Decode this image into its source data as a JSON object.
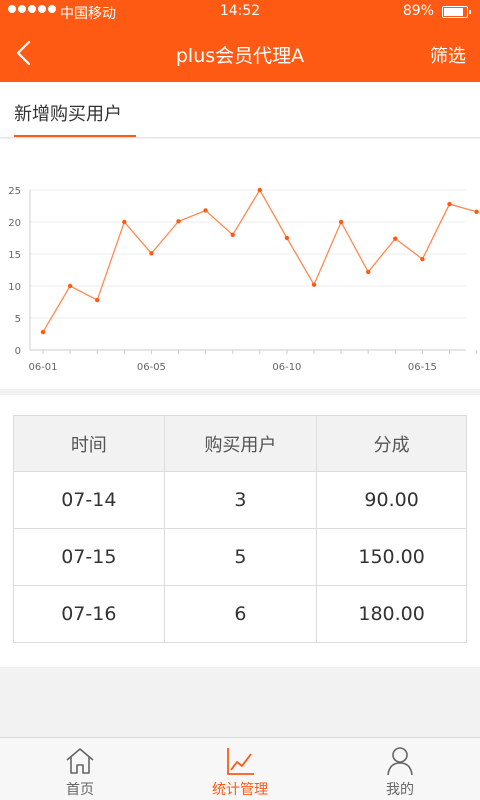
{
  "status_bar": {
    "carrier": "中国移动",
    "time": "14:52",
    "battery": "89%",
    "battery_level": 0.89
  },
  "nav": {
    "title": "plus会员代理A",
    "filter_label": "筛选",
    "back_icon": "chevron-left-icon"
  },
  "tab": {
    "label": "新增购买用户"
  },
  "colors": {
    "accent": "#ff5a14",
    "line": "#ff8a50"
  },
  "chart_data": {
    "type": "line",
    "title": "",
    "xlabel": "",
    "ylabel": "",
    "ylim": [
      0,
      25
    ],
    "yticks": [
      0,
      5,
      10,
      15,
      20,
      25
    ],
    "xticks": [
      "06-01",
      "06-05",
      "06-10",
      "06-15"
    ],
    "grid": true,
    "series": [
      {
        "x": [
          1,
          2,
          3,
          4,
          5,
          6,
          7,
          8,
          9,
          10,
          11,
          12,
          13,
          14,
          15,
          16,
          17
        ],
        "values": [
          2.8,
          10,
          7.8,
          20,
          15.1,
          20.1,
          21.8,
          18,
          25,
          17.5,
          10.2,
          20,
          12.2,
          17.4,
          14.2,
          22.8,
          21.6
        ]
      }
    ]
  },
  "table": {
    "headers": [
      "时间",
      "购买用户",
      "分成"
    ],
    "rows": [
      [
        "07-14",
        "3",
        "90.00"
      ],
      [
        "07-15",
        "5",
        "150.00"
      ],
      [
        "07-16",
        "6",
        "180.00"
      ]
    ]
  },
  "tabbar": {
    "items": [
      {
        "label": "首页",
        "icon": "home-icon",
        "active": false
      },
      {
        "label": "统计管理",
        "icon": "chart-icon",
        "active": true
      },
      {
        "label": "我的",
        "icon": "user-icon",
        "active": false
      }
    ]
  }
}
